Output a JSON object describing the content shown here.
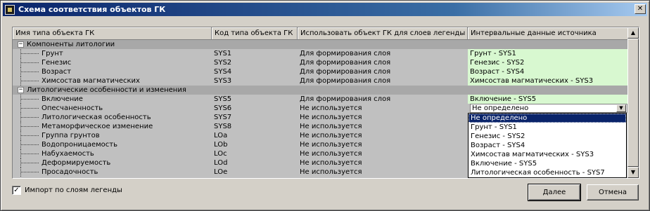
{
  "window": {
    "title": "Схема соответствия объектов ГК"
  },
  "table": {
    "headers": [
      "Имя типа объекта ГК",
      "Код типа объекта ГК",
      "Использовать объект ГК для слоев легенды",
      "Интервальные данные источника"
    ],
    "groups": [
      {
        "toggle": "−",
        "label": "Компоненты литологии",
        "rows": [
          {
            "name": "Грунт",
            "code": "SYS1",
            "use": "Для формирования слоя",
            "source": "Грунт - SYS1"
          },
          {
            "name": "Генезис",
            "code": "SYS2",
            "use": "Для формирования слоя",
            "source": "Генезис - SYS2"
          },
          {
            "name": "Возраст",
            "code": "SYS4",
            "use": "Для формирования слоя",
            "source": "Возраст - SYS4"
          },
          {
            "name": "Химсостав магматических",
            "code": "SYS3",
            "use": "Для формирования слоя",
            "source": "Химсостав магматических - SYS3"
          }
        ]
      },
      {
        "toggle": "−",
        "label": "Литологические особенности и изменения",
        "rows": [
          {
            "name": "Включение",
            "code": "SYS5",
            "use": "Для формирования слоя",
            "source": "Включение - SYS5"
          },
          {
            "name": "Опесчаненность",
            "code": "SYS6",
            "use": "Не используется",
            "source": "Не определено"
          },
          {
            "name": "Литологическая особенность",
            "code": "SYS7",
            "use": "Не используется",
            "source": ""
          },
          {
            "name": "Метаморфическое изменение",
            "code": "SYS8",
            "use": "Не используется",
            "source": ""
          },
          {
            "name": "Группа грунтов",
            "code": "LOa",
            "use": "Не используется",
            "source": ""
          },
          {
            "name": "Водопроницаемость",
            "code": "LOb",
            "use": "Не используется",
            "source": ""
          },
          {
            "name": "Набухаемость",
            "code": "LOc",
            "use": "Не используется",
            "source": ""
          },
          {
            "name": "Деформируемость",
            "code": "LOd",
            "use": "Не используется",
            "source": ""
          },
          {
            "name": "Просадочность",
            "code": "LOe",
            "use": "Не используется",
            "source": ""
          }
        ]
      }
    ]
  },
  "dropdown": {
    "options": [
      "Не определено",
      "Грунт - SYS1",
      "Генезис - SYS2",
      "Возраст - SYS4",
      "Химсостав магматических - SYS3",
      "Включение - SYS5",
      "Литологическая особенность - SYS7"
    ],
    "selected_index": 0
  },
  "import_checkbox": {
    "label": "Импорт по слоям легенды",
    "checked": true,
    "mark": "✓"
  },
  "buttons": {
    "next": "Далее",
    "cancel": "Отмена"
  },
  "colors": {
    "mapped_cell": "#d8f8d0",
    "group_row": "#a8a8a8",
    "selection": "#0a246a"
  }
}
